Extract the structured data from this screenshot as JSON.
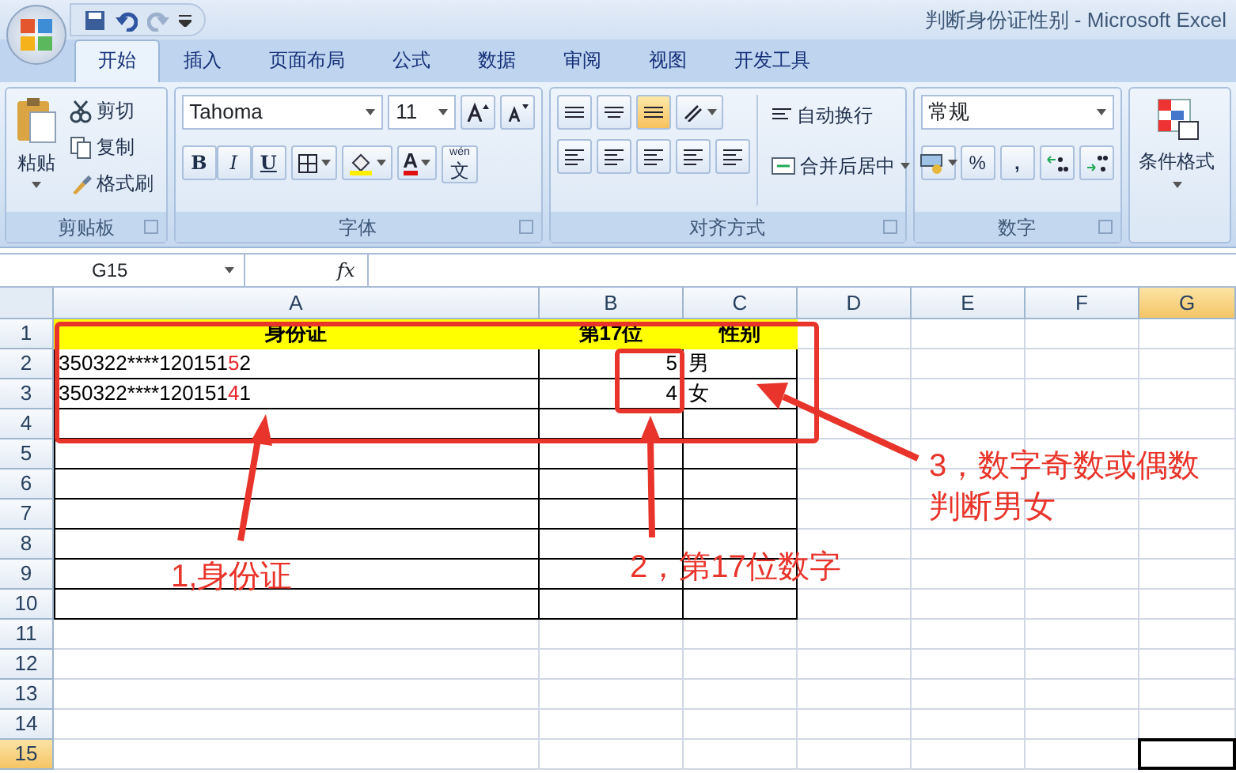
{
  "window": {
    "title": "判断身份证性别 - Microsoft Excel"
  },
  "tabs": [
    {
      "label": "开始",
      "selected": true
    },
    {
      "label": "插入",
      "selected": false
    },
    {
      "label": "页面布局",
      "selected": false
    },
    {
      "label": "公式",
      "selected": false
    },
    {
      "label": "数据",
      "selected": false
    },
    {
      "label": "审阅",
      "selected": false
    },
    {
      "label": "视图",
      "selected": false
    },
    {
      "label": "开发工具",
      "selected": false
    }
  ],
  "ribbon": {
    "clipboard": {
      "label": "剪贴板",
      "paste": "粘贴",
      "cut": "剪切",
      "copy": "复制",
      "format_painter": "格式刷"
    },
    "font": {
      "label": "字体",
      "font_name": "Tahoma",
      "font_size": "11",
      "bold": "B",
      "italic": "I",
      "underline": "U",
      "font_color_glyph": "A",
      "phonetic": "wén",
      "phonetic_char": "文"
    },
    "alignment": {
      "label": "对齐方式",
      "wrap_text": "自动换行",
      "merge_center": "合并后居中"
    },
    "number": {
      "label": "数字",
      "format": "常规",
      "percent": "%",
      "comma": ","
    },
    "styles": {
      "conditional_format": "条件格式"
    }
  },
  "formula_bar": {
    "name_box": "G15",
    "fx": "fx"
  },
  "columns": [
    {
      "label": "A",
      "selected": false
    },
    {
      "label": "B",
      "selected": false
    },
    {
      "label": "C",
      "selected": false
    },
    {
      "label": "D",
      "selected": false
    },
    {
      "label": "E",
      "selected": false
    },
    {
      "label": "F",
      "selected": false
    },
    {
      "label": "G",
      "selected": true
    }
  ],
  "rows": [
    {
      "header": "1",
      "selected": false,
      "kind": "header",
      "cells": [
        {
          "segments": [
            {
              "text": "身份证",
              "marked": false
            }
          ]
        },
        {
          "segments": [
            {
              "text": "第17位",
              "marked": false
            }
          ]
        },
        {
          "segments": [
            {
              "text": "性别",
              "marked": false
            }
          ]
        }
      ]
    },
    {
      "header": "2",
      "selected": false,
      "kind": "data",
      "cells": [
        {
          "segments": [
            {
              "text": "350322****120151",
              "marked": false
            },
            {
              "text": "5",
              "marked": true
            },
            {
              "text": "2",
              "marked": false
            }
          ]
        },
        {
          "segments": [
            {
              "text": "5",
              "marked": false
            }
          ],
          "kind": "number"
        },
        {
          "segments": [
            {
              "text": "男",
              "marked": false
            }
          ]
        }
      ]
    },
    {
      "header": "3",
      "selected": false,
      "kind": "data",
      "cells": [
        {
          "segments": [
            {
              "text": "350322****120151",
              "marked": false
            },
            {
              "text": "4",
              "marked": true
            },
            {
              "text": "1",
              "marked": false
            }
          ]
        },
        {
          "segments": [
            {
              "text": "4",
              "marked": false
            }
          ],
          "kind": "number"
        },
        {
          "segments": [
            {
              "text": "女",
              "marked": false
            }
          ]
        }
      ]
    },
    {
      "header": "4",
      "selected": false
    },
    {
      "header": "5",
      "selected": false
    },
    {
      "header": "6",
      "selected": false
    },
    {
      "header": "7",
      "selected": false
    },
    {
      "header": "8",
      "selected": false
    },
    {
      "header": "9",
      "selected": false
    },
    {
      "header": "10",
      "selected": false
    },
    {
      "header": "11",
      "selected": false
    },
    {
      "header": "12",
      "selected": false
    },
    {
      "header": "13",
      "selected": false
    },
    {
      "header": "14",
      "selected": false
    },
    {
      "header": "15",
      "selected": true
    }
  ],
  "annotations": [
    {
      "text": "1,身份证"
    },
    {
      "text": "2，第17位数字"
    },
    {
      "text": "3，数字奇数或偶数判断男女"
    }
  ]
}
